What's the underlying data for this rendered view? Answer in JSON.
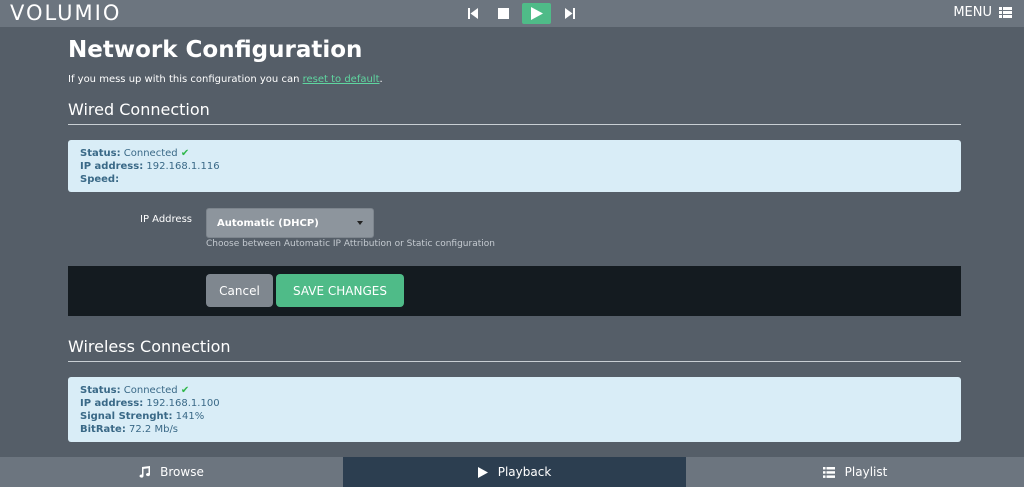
{
  "header": {
    "logo": "VOLUMIO",
    "menu_label": "MENU"
  },
  "page": {
    "title": "Network Configuration",
    "intro_text": "If you mess up with this configuration you can ",
    "intro_link": "reset to default",
    "intro_end": "."
  },
  "wired": {
    "title": "Wired Connection",
    "status_label": "Status:",
    "status_value": " Connected ",
    "ip_label": "IP address:",
    "ip_value": " 192.168.1.116",
    "speed_label": "Speed:",
    "speed_value": "",
    "ip_field_label": "IP Address",
    "ip_mode": "Automatic (DHCP)",
    "help_text": "Choose between Automatic IP Attribution or Static configuration",
    "cancel_label": "Cancel",
    "save_label": "SAVE CHANGES"
  },
  "wireless": {
    "title": "Wireless Connection",
    "status_label": "Status:",
    "status_value": " Connected ",
    "ip_label": "IP address:",
    "ip_value": " 192.168.1.100",
    "signal_label": "Signal Strenght:",
    "signal_value": " 141%",
    "bitrate_label": "BitRate:",
    "bitrate_value": " 72.2 Mb/s"
  },
  "nav": {
    "browse": "Browse",
    "playback": "Playback",
    "playlist": "Playlist"
  },
  "colors": {
    "accent": "#4fbb88",
    "background": "#555e68",
    "bar": "#6c757f",
    "active_tab": "#2c3e50",
    "info_bg": "#d9edf7"
  }
}
